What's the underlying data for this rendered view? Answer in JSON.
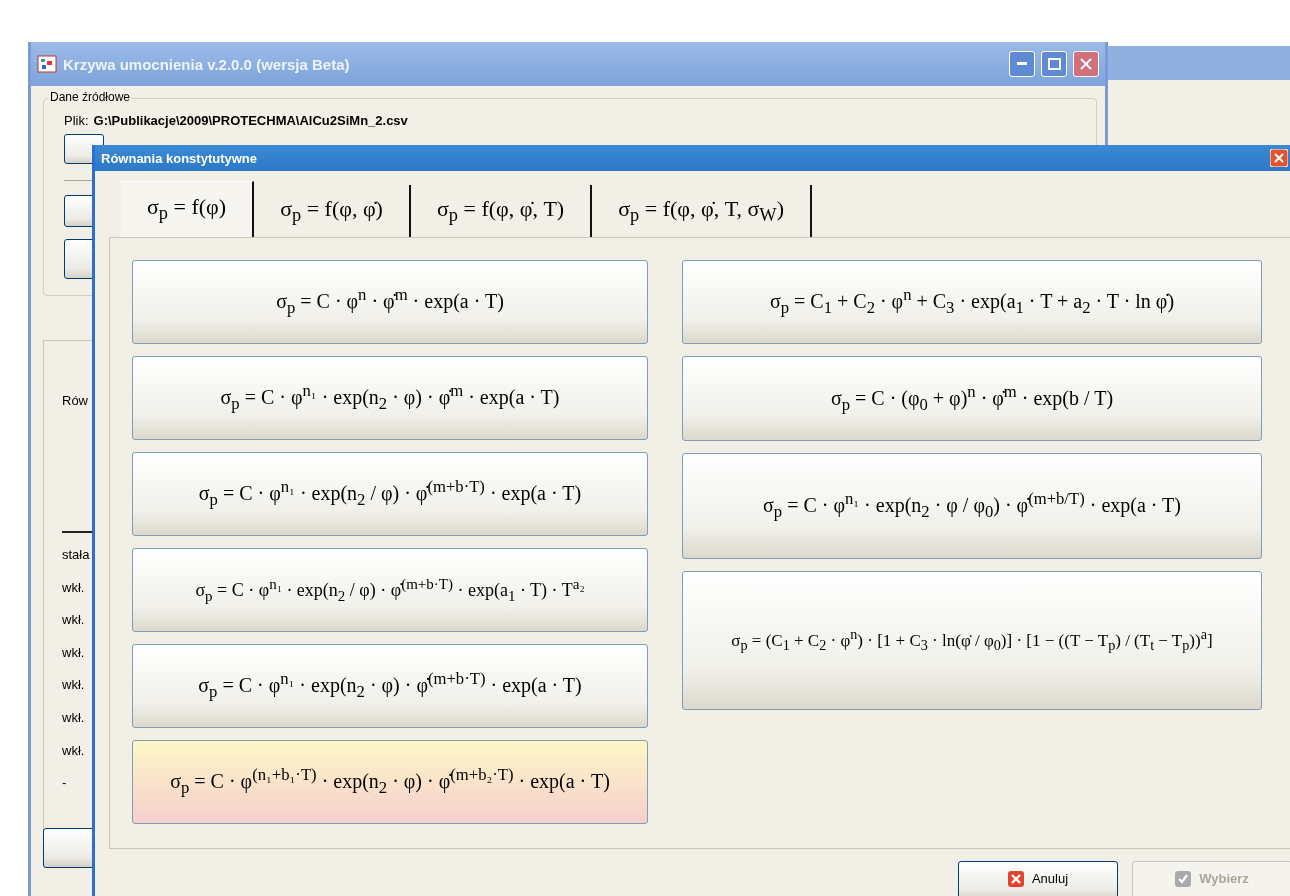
{
  "main_window": {
    "title": "Krzywa umocnienia v.2.0.0 (wersja Beta)",
    "source_group": {
      "title": "Dane źródłowe",
      "file_label": "Plik:",
      "file_path": "G:\\Publikacje\\2009\\PROTECHMA\\AlCu2SiMn_2.csv"
    },
    "side_labels": [
      "Rów"
    ],
    "result_labels": [
      "stała",
      "wkł.",
      "wkł.",
      "wkł.",
      "wkł.",
      "wkł.",
      "wkł.",
      "-"
    ]
  },
  "dialog": {
    "title": "Równania konstytutywne",
    "tabs": [
      {
        "label": "σ$_{p}$ = f(φ)",
        "selected": true
      },
      {
        "label": "σ$_{p}$ = f(φ, φ̇)",
        "selected": false
      },
      {
        "label": "σ$_{p}$ = f(φ, φ̇, T)",
        "selected": false
      },
      {
        "label": "σ$_{p}$ = f(φ, φ̇, T, σ$_{W}$)",
        "selected": false
      }
    ],
    "left_equations": [
      {
        "formula": "σ$_{p}$ = C · φ$^{n}$ · φ̇$^{m}$ · exp(a · T)",
        "selected": false
      },
      {
        "formula": "σ$_{p}$ = C · φ$^{n₁}$ · exp(n$_{2}$ · φ) · φ̇$^{m}$ · exp(a · T)",
        "selected": false
      },
      {
        "formula": "σ$_{p}$ = C · φ$^{n₁}$ · exp(n$_{2}$ / φ) · φ̇$^{(m+b·T)}$ · exp(a · T)",
        "selected": false
      },
      {
        "formula": "σ$_{p}$ = C · φ$^{n₁}$ · exp(n$_{2}$ / φ) · φ̇$^{(m+b·T)}$ · exp(a$_{1}$ · T) · T$^{a₂}$",
        "selected": false
      },
      {
        "formula": "σ$_{p}$ = C · φ$^{n₁}$ · exp(n$_{2}$ · φ) · φ̇$^{(m+b·T)}$ · exp(a · T)",
        "selected": false
      },
      {
        "formula": "σ$_{p}$ = C · φ$^{(n₁+b₁·T)}$ · exp(n$_{2}$ · φ) · φ̇$^{(m+b₂·T)}$ · exp(a · T)",
        "selected": true
      }
    ],
    "right_equations": [
      {
        "formula": "σ$_{p}$ = C$_{1}$ + C$_{2}$ · φ$^{n}$ + C$_{3}$ · exp(a$_{1}$ · T + a$_{2}$ · T · ln φ̇)",
        "selected": false
      },
      {
        "formula": "σ$_{p}$ = C · (φ$_{0}$ + φ)$^{n}$ · φ̇$^{m}$ · exp(b / T)",
        "selected": false
      },
      {
        "formula": "σ$_{p}$ = C · φ$^{n₁}$ · exp(n$_{2}$ · φ / φ$_{0}$) · φ̇$^{(m+b/T)}$ · exp(a · T)",
        "selected": false
      },
      {
        "formula": "σ$_{p}$ = (C$_{1}$ + C$_{2}$ · φ$^{n}$) · [1 + C$_{3}$ · ln(φ̇ / φ$_{0}$)] · [1 − ((T − T$_{p}$) / (T$_{t}$ − T$_{p}$))$^{a}$]",
        "selected": false
      }
    ],
    "buttons": [
      {
        "label": "Anuluj",
        "kind": "cancel",
        "disabled": false
      },
      {
        "label": "Wybierz",
        "kind": "accept",
        "disabled": true
      }
    ]
  }
}
